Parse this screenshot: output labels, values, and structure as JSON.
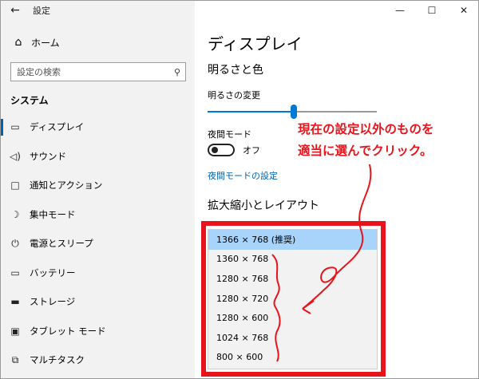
{
  "app": {
    "title": "設定"
  },
  "sidebar": {
    "home_label": "ホーム",
    "search_placeholder": "設定の検索",
    "section_title": "システム",
    "items": [
      {
        "label": "ディスプレイ",
        "icon": "monitor-icon"
      },
      {
        "label": "サウンド",
        "icon": "speaker-icon"
      },
      {
        "label": "通知とアクション",
        "icon": "notification-icon"
      },
      {
        "label": "集中モード",
        "icon": "moon-icon"
      },
      {
        "label": "電源とスリープ",
        "icon": "power-icon"
      },
      {
        "label": "バッテリー",
        "icon": "battery-icon"
      },
      {
        "label": "ストレージ",
        "icon": "storage-icon"
      },
      {
        "label": "タブレット モード",
        "icon": "tablet-icon"
      },
      {
        "label": "マルチタスク",
        "icon": "multitask-icon"
      }
    ]
  },
  "main": {
    "page_title": "ディスプレイ",
    "brightness_section": "明るさと色",
    "brightness_label": "明るさの変更",
    "brightness_value": 0.51,
    "night_mode_label": "夜間モード",
    "night_mode_state": "オフ",
    "night_mode_link": "夜間モードの設定",
    "scale_section": "拡大縮小とレイアウト"
  },
  "resolution_dropdown": {
    "selected_index": 0,
    "options": [
      "1366 × 768 (推奨)",
      "1360 × 768",
      "1280 × 768",
      "1280 × 720",
      "1280 × 600",
      "1024 × 768",
      "800 × 600"
    ]
  },
  "annotation": {
    "line1": "現在の設定以外のものを",
    "line2": "適当に選んでクリック。",
    "color": "#e8141c"
  },
  "colors": {
    "accent": "#0078d7",
    "link": "#0063b1",
    "highlight": "#e8141c",
    "selection": "#a8d3fb"
  }
}
